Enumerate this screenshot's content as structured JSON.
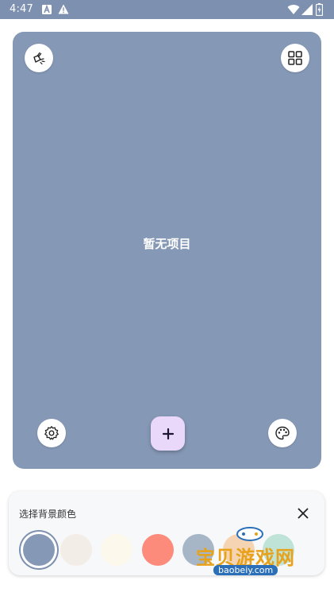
{
  "status_bar": {
    "time": "4:47",
    "icons": [
      "a-notification-icon",
      "warning-icon",
      "wifi-icon",
      "signal-icon",
      "battery-icon"
    ]
  },
  "main_card": {
    "background": "#8598b6",
    "empty_message": "暂无项目",
    "top_left_icon": "clean-brush-icon",
    "top_right_icon": "grid-icon",
    "bottom_left_icon": "settings-icon",
    "bottom_right_icon": "palette-icon",
    "add_icon": "plus-icon",
    "add_button_color": "#ead8fb"
  },
  "color_picker": {
    "title": "选择背景颜色",
    "close_icon": "close-icon",
    "selected": "#8598b6",
    "swatches": [
      "#8598b6",
      "#f2ede6",
      "#fdf8ec",
      "#fd8b7c",
      "#a7b6c6",
      "#f5d4b4",
      "#bfe3d7"
    ]
  },
  "watermark": {
    "text": "宝贝游戏网",
    "url": "baobeiy.com"
  }
}
